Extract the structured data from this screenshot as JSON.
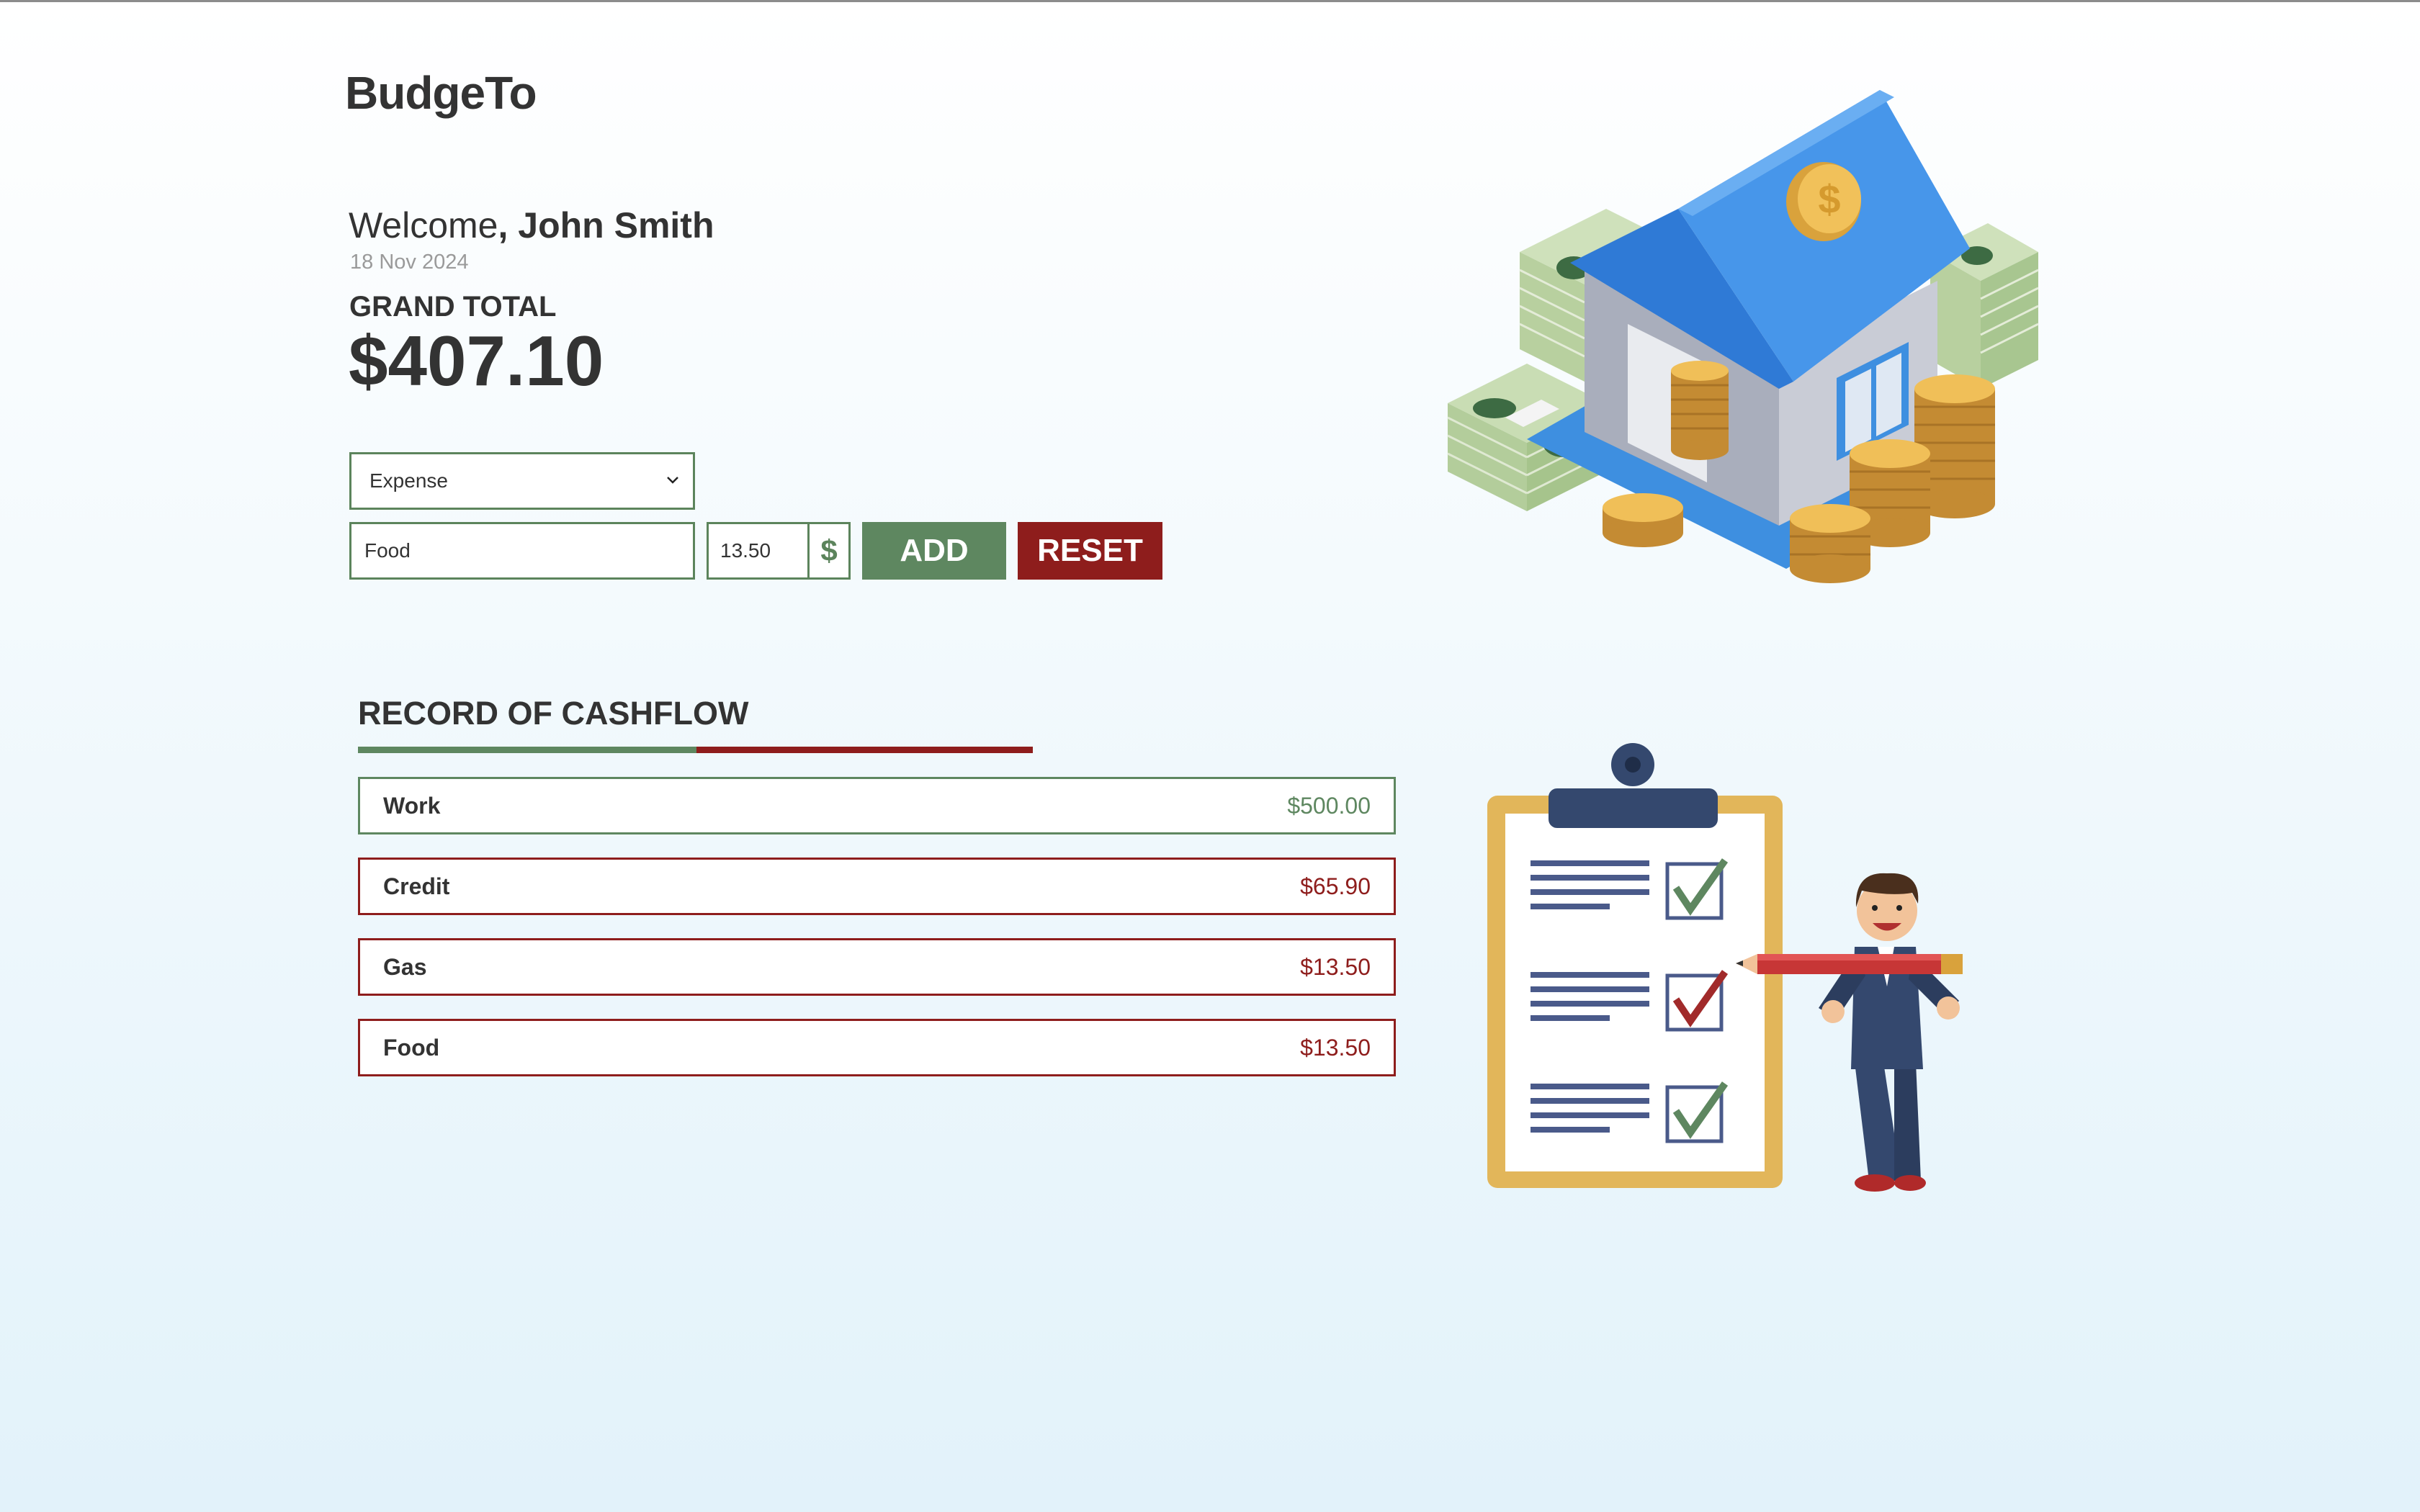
{
  "app": {
    "title": "BudgeTo"
  },
  "header": {
    "welcome_label": "Welcome",
    "welcome_sep": ", ",
    "user_name": "John Smith",
    "date": "18 Nov 2024"
  },
  "summary": {
    "grand_total_label": "GRAND TOTAL",
    "grand_total_value": "$407.10"
  },
  "form": {
    "type_selected": "Expense",
    "description_value": "Food",
    "amount_value": "13.50",
    "currency_symbol": "$",
    "add_label": "ADD",
    "reset_label": "RESET"
  },
  "records": {
    "title": "RECORD OF CASHFLOW",
    "items": [
      {
        "label": "Work",
        "amount": "$500.00",
        "kind": "income"
      },
      {
        "label": "Credit",
        "amount": "$65.90",
        "kind": "expense"
      },
      {
        "label": "Gas",
        "amount": "$13.50",
        "kind": "expense"
      },
      {
        "label": "Food",
        "amount": "$13.50",
        "kind": "expense"
      }
    ]
  },
  "colors": {
    "income": "#5e8760",
    "expense": "#8e1d1c",
    "text": "#333333"
  },
  "icons": {
    "select_arrow": "chevron-down-icon",
    "currency": "dollar-icon"
  }
}
